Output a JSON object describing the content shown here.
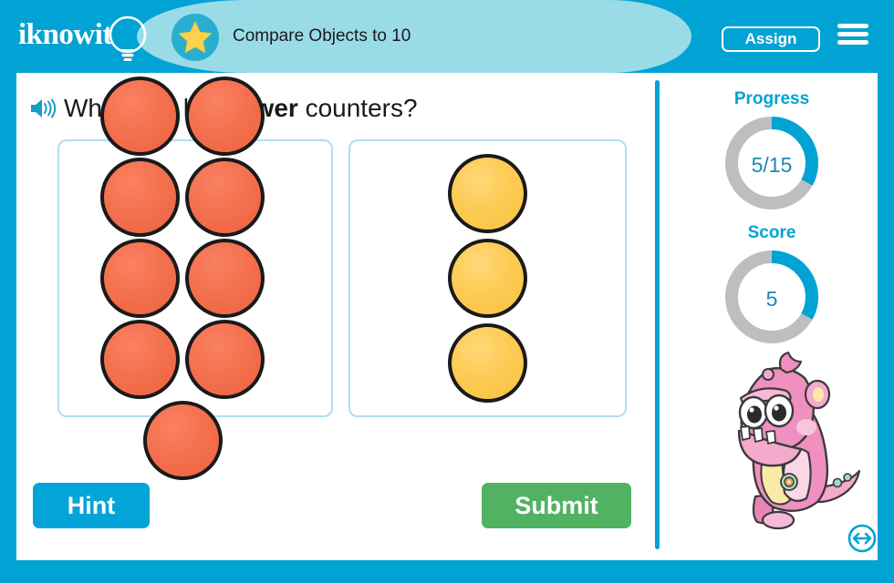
{
  "brand": {
    "logo_text": "iknowit",
    "logo_icon": "lightbulb-icon"
  },
  "header": {
    "star_icon": "star-icon",
    "lesson_title": "Compare Objects to 10",
    "assign_label": "Assign",
    "menu_icon": "hamburger-menu-icon",
    "bg_color": "#00a3d3",
    "panel_color": "#9adbe8"
  },
  "question": {
    "speaker_icon": "speaker-icon",
    "prefix": "Which set has ",
    "emphasis": "fewer",
    "suffix": " counters?"
  },
  "sets": [
    {
      "name": "red-counter-set",
      "color": "red",
      "count": 9,
      "layout": "grid-3x3"
    },
    {
      "name": "yellow-counter-set",
      "color": "yellow",
      "count": 3,
      "layout": "column"
    }
  ],
  "actions": {
    "hint_label": "Hint",
    "hint_color": "#03a4d7",
    "submit_label": "Submit",
    "submit_color": "#51b262"
  },
  "sidebar": {
    "progress": {
      "label": "Progress",
      "value": "5/15",
      "current": 5,
      "total": 15,
      "percent": 33
    },
    "score": {
      "label": "Score",
      "value": "5",
      "percent": 33
    },
    "dial_fill_color": "#00a3d3",
    "dial_track_color": "#bcbec0",
    "mascot_icon": "pink-dragon-mascot",
    "resize_icon": "resize-horizontal-icon"
  }
}
